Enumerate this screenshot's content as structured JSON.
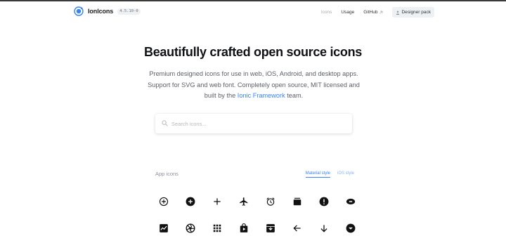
{
  "header": {
    "brand_name": "IonIcons",
    "version": "4.5.10-0",
    "nav": {
      "icons": "Icons",
      "usage": "Usage",
      "github": "GitHub",
      "designer_pack": "Designer pack"
    }
  },
  "hero": {
    "title": "Beautifully crafted open source icons",
    "desc_line1": "Premium designed icons for use in web, iOS, Android, and desktop apps.",
    "desc_line2": "Support for SVG and web font. Completely open source, MIT licensed and",
    "desc_pre_link": "built by the ",
    "desc_link": "Ionic Framework",
    "desc_post_link": " team."
  },
  "search": {
    "placeholder": "Search icons..."
  },
  "icons_section": {
    "title": "App icons",
    "tabs": {
      "material": "Material style",
      "ios": "iOS style"
    },
    "active_tab": "material",
    "rows": [
      [
        "add-circle-outline-icon",
        "add-circle-icon",
        "add-icon",
        "airplane-icon",
        "alarm-icon",
        "albums-icon",
        "alert-icon",
        "american-football-icon"
      ],
      [
        "analytics-icon",
        "aperture-icon",
        "apps-icon",
        "appstore-icon",
        "archive-icon",
        "arrow-back-icon",
        "arrow-down-icon",
        "arrow-dropdown-circle-icon"
      ]
    ]
  },
  "colors": {
    "accent": "#3880ff",
    "text": "#111215",
    "muted": "#5b6067",
    "badge_bg": "#eef1f4"
  }
}
